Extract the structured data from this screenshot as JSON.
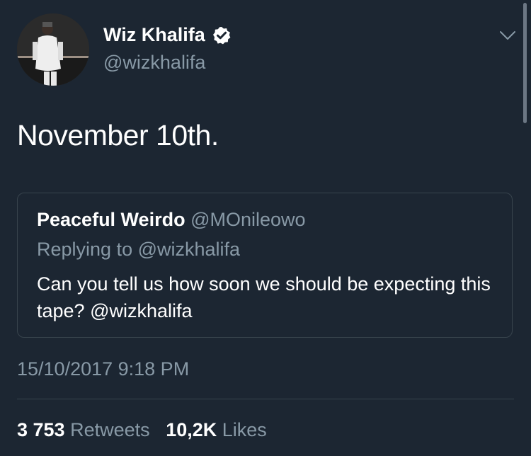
{
  "author": {
    "display_name": "Wiz Khalifa",
    "handle": "@wizkhalifa",
    "verified": true,
    "avatar_icon": "profile-photo"
  },
  "tweet": {
    "text": "November 10th.",
    "timestamp": "15/10/2017 9:18 PM"
  },
  "quoted_tweet": {
    "display_name": "Peaceful Weirdo",
    "handle": "@MOnileowo",
    "replying_to": "Replying to @wizkhalifa",
    "text": "Can you tell us how soon we should be expecting this tape? @wizkhalifa"
  },
  "stats": {
    "retweets_count": "3 753",
    "retweets_label": "Retweets",
    "likes_count": "10,2K",
    "likes_label": "Likes"
  },
  "colors": {
    "background": "#1c2632",
    "secondary_text": "#8899a6",
    "border": "#38444d",
    "verified_badge": "#ffffff"
  }
}
